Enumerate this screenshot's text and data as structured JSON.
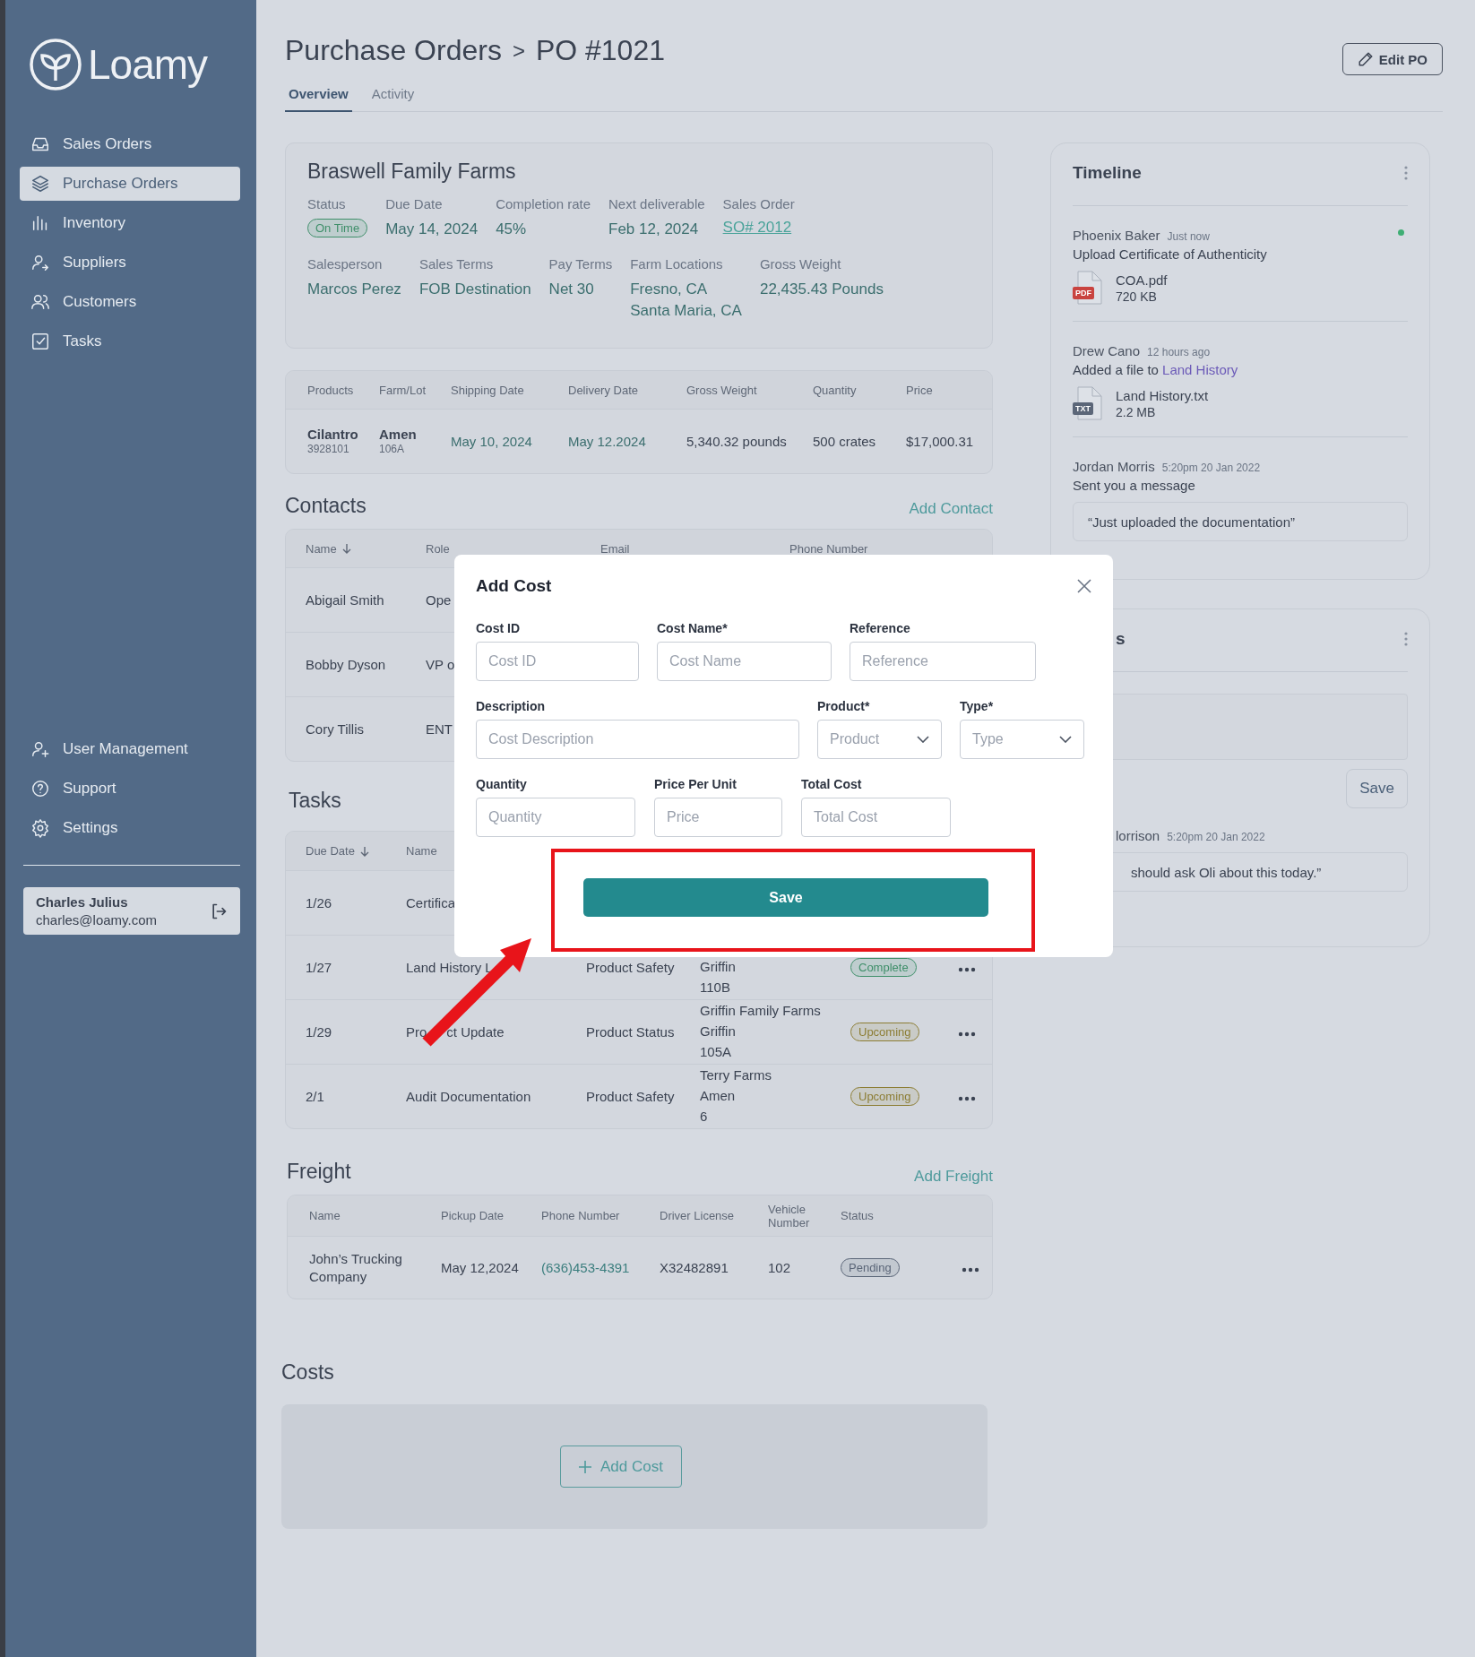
{
  "sidebar": {
    "logo": "Loamy",
    "nav": [
      {
        "label": "Sales Orders",
        "selected": false
      },
      {
        "label": "Purchase Orders",
        "selected": true
      },
      {
        "label": "Inventory",
        "selected": false
      },
      {
        "label": "Suppliers",
        "selected": false
      },
      {
        "label": "Customers",
        "selected": false
      },
      {
        "label": "Tasks",
        "selected": false
      }
    ],
    "bottom_nav": [
      {
        "label": "User Management"
      },
      {
        "label": "Support"
      },
      {
        "label": "Settings"
      }
    ],
    "user": {
      "name": "Charles Julius",
      "email": "charles@loamy.com"
    }
  },
  "header": {
    "breadcrumb": [
      "Purchase Orders",
      "PO #1021"
    ],
    "separator": ">",
    "edit_button": "Edit PO",
    "tabs": [
      {
        "label": "Overview",
        "selected": true
      },
      {
        "label": "Activity",
        "selected": false
      }
    ]
  },
  "summary": {
    "title": "Braswell Family Farms",
    "row_1": [
      {
        "label": "Status",
        "badge": {
          "text": "On Time",
          "color": "#3f8f6a"
        }
      },
      {
        "label": "Due Date",
        "value": [
          "May 14, 2024"
        ]
      },
      {
        "label": "Completion rate",
        "value": [
          "45%"
        ]
      },
      {
        "label": "Next deliverable",
        "value": [
          "Feb 12, 2024"
        ]
      },
      {
        "label": "Sales Order",
        "link": "SO# 2012"
      }
    ],
    "row_2": [
      {
        "label": "Salesperson",
        "value": [
          "Marcos Perez"
        ]
      },
      {
        "label": "Sales Terms",
        "value": [
          "FOB Destination"
        ]
      },
      {
        "label": "Pay Terms",
        "value": [
          "Net 30"
        ]
      },
      {
        "label": "Farm Locations",
        "value": [
          "Fresno, CA",
          "Santa Maria, CA"
        ]
      },
      {
        "label": "Gross Weight",
        "value": [
          "22,435.43 Pounds"
        ]
      }
    ]
  },
  "products": {
    "columns": [
      {
        "label": "Products",
        "kind": "stacked"
      },
      {
        "label": "Farm/Lot",
        "kind": "stacked"
      },
      {
        "label": "Shipping Date",
        "kind": "date"
      },
      {
        "label": "Delivery Date",
        "kind": "date"
      },
      {
        "label": "Gross Weight",
        "kind": "text"
      },
      {
        "label": "Quantity",
        "kind": "text"
      },
      {
        "label": "Price",
        "kind": "text"
      }
    ],
    "rows": [
      [
        {
          "text": "Cilantro",
          "sub": "3928101"
        },
        {
          "text": "Amen",
          "sub": "106A"
        },
        {
          "text": "May 10, 2024"
        },
        {
          "text": "May 12.2024"
        },
        {
          "text": "5,340.32 pounds"
        },
        {
          "text": "500 crates"
        },
        {
          "text": "$17,000.31"
        }
      ]
    ]
  },
  "contacts": {
    "title": "Contacts",
    "action": "Add Contact",
    "columns": [
      {
        "label": "Name",
        "sorted": true
      },
      {
        "label": "Role",
        "sorted": false
      },
      {
        "label": "Email",
        "sorted": false
      },
      {
        "label": "Phone Number",
        "sorted": false
      }
    ],
    "rows": [
      [
        "Abigail Smith",
        "Ope"
      ],
      [
        "Bobby Dyson",
        "VP o"
      ],
      [
        "Cory Tillis",
        "ENT"
      ]
    ]
  },
  "tasks": {
    "title": "Tasks",
    "columns": [
      {
        "label": "Due Date",
        "sorted": true
      },
      {
        "label": "Name",
        "sorted": false
      }
    ],
    "rows": [
      {
        "date": "1/26",
        "name": "Certifica"
      },
      {
        "date": "1/27",
        "name": "Land History L",
        "type": "Product Safety",
        "location": [
          "Griffin",
          "110B"
        ],
        "status": {
          "text": "Complete",
          "color": "#3f8f6a"
        }
      },
      {
        "date": "1/29",
        "name": [
          "Pro",
          "ct Update"
        ],
        "type": "Product Status",
        "location": [
          "Griffin Family Farms",
          "Griffin",
          "105A"
        ],
        "status": {
          "text": "Upcoming",
          "color": "#8c7d34"
        }
      },
      {
        "date": "2/1",
        "name": "Audit Documentation",
        "type": "Product Safety",
        "location": [
          "Terry Farms",
          "Amen",
          "6"
        ],
        "status": {
          "text": "Upcoming",
          "color": "#8c7d34"
        }
      }
    ]
  },
  "freight": {
    "title": "Freight",
    "action": "Add Freight",
    "columns": [
      "Name",
      "Pickup Date",
      "Phone Number",
      "Driver License",
      "Vehicle Number",
      "Status"
    ],
    "rows": [
      {
        "name": "John’s Trucking Company",
        "pickup": "May 12,2024",
        "phone": "(636)453-4391",
        "license": "X32482891",
        "vehicle": "102",
        "status": {
          "text": "Pending",
          "color": "#5b6678"
        }
      }
    ]
  },
  "costs": {
    "title": "Costs",
    "button": "Add Cost"
  },
  "timeline": {
    "title": "Timeline",
    "items": [
      {
        "author": "Phoenix Baker",
        "time": "Just now",
        "message": "Upload Certificate of Authenticity",
        "unread": true,
        "file": {
          "kind": "pdf",
          "type": "PDF",
          "name": "COA.pdf",
          "size": "720 KB"
        }
      },
      {
        "author": "Drew Cano",
        "time": "12 hours ago",
        "message": "Added a file to",
        "link": "Land History",
        "unread": false,
        "file": {
          "kind": "txt",
          "type": "TXT",
          "name": "Land History.txt",
          "size": "2.2 MB"
        }
      },
      {
        "author": "Jordan Morris",
        "time": "5:20pm 20 Jan 2022",
        "message": "Sent you a message",
        "unread": false,
        "quote": "“Just uploaded the documentation”"
      }
    ]
  },
  "comments": {
    "title": "s",
    "save": "Save",
    "author": "lorrison",
    "time": "5:20pm 20 Jan 2022",
    "quote": "should ask Oli about this today.”"
  },
  "modal": {
    "title": "Add Cost",
    "rows": [
      [
        {
          "label": "Cost ID",
          "placeholder": "Cost ID",
          "kind": "input"
        },
        {
          "label": "Cost Name*",
          "placeholder": "Cost Name",
          "kind": "input"
        },
        {
          "label": "Reference",
          "placeholder": "Reference",
          "kind": "input"
        }
      ],
      [
        {
          "label": "Description",
          "placeholder": "Cost Description",
          "kind": "input"
        },
        {
          "label": "Product*",
          "placeholder": "Product",
          "kind": "select"
        },
        {
          "label": "Type*",
          "placeholder": "Type",
          "kind": "select"
        }
      ],
      [
        {
          "label": "Quantity",
          "placeholder": "Quantity",
          "kind": "input"
        },
        {
          "label": "Price Per Unit",
          "placeholder": "Price",
          "kind": "input"
        },
        {
          "label": "Total Cost",
          "placeholder": "Total Cost",
          "kind": "input"
        }
      ]
    ],
    "save": "Save"
  },
  "annotations": {
    "highlight_box": true,
    "pointer_arrow": true
  }
}
